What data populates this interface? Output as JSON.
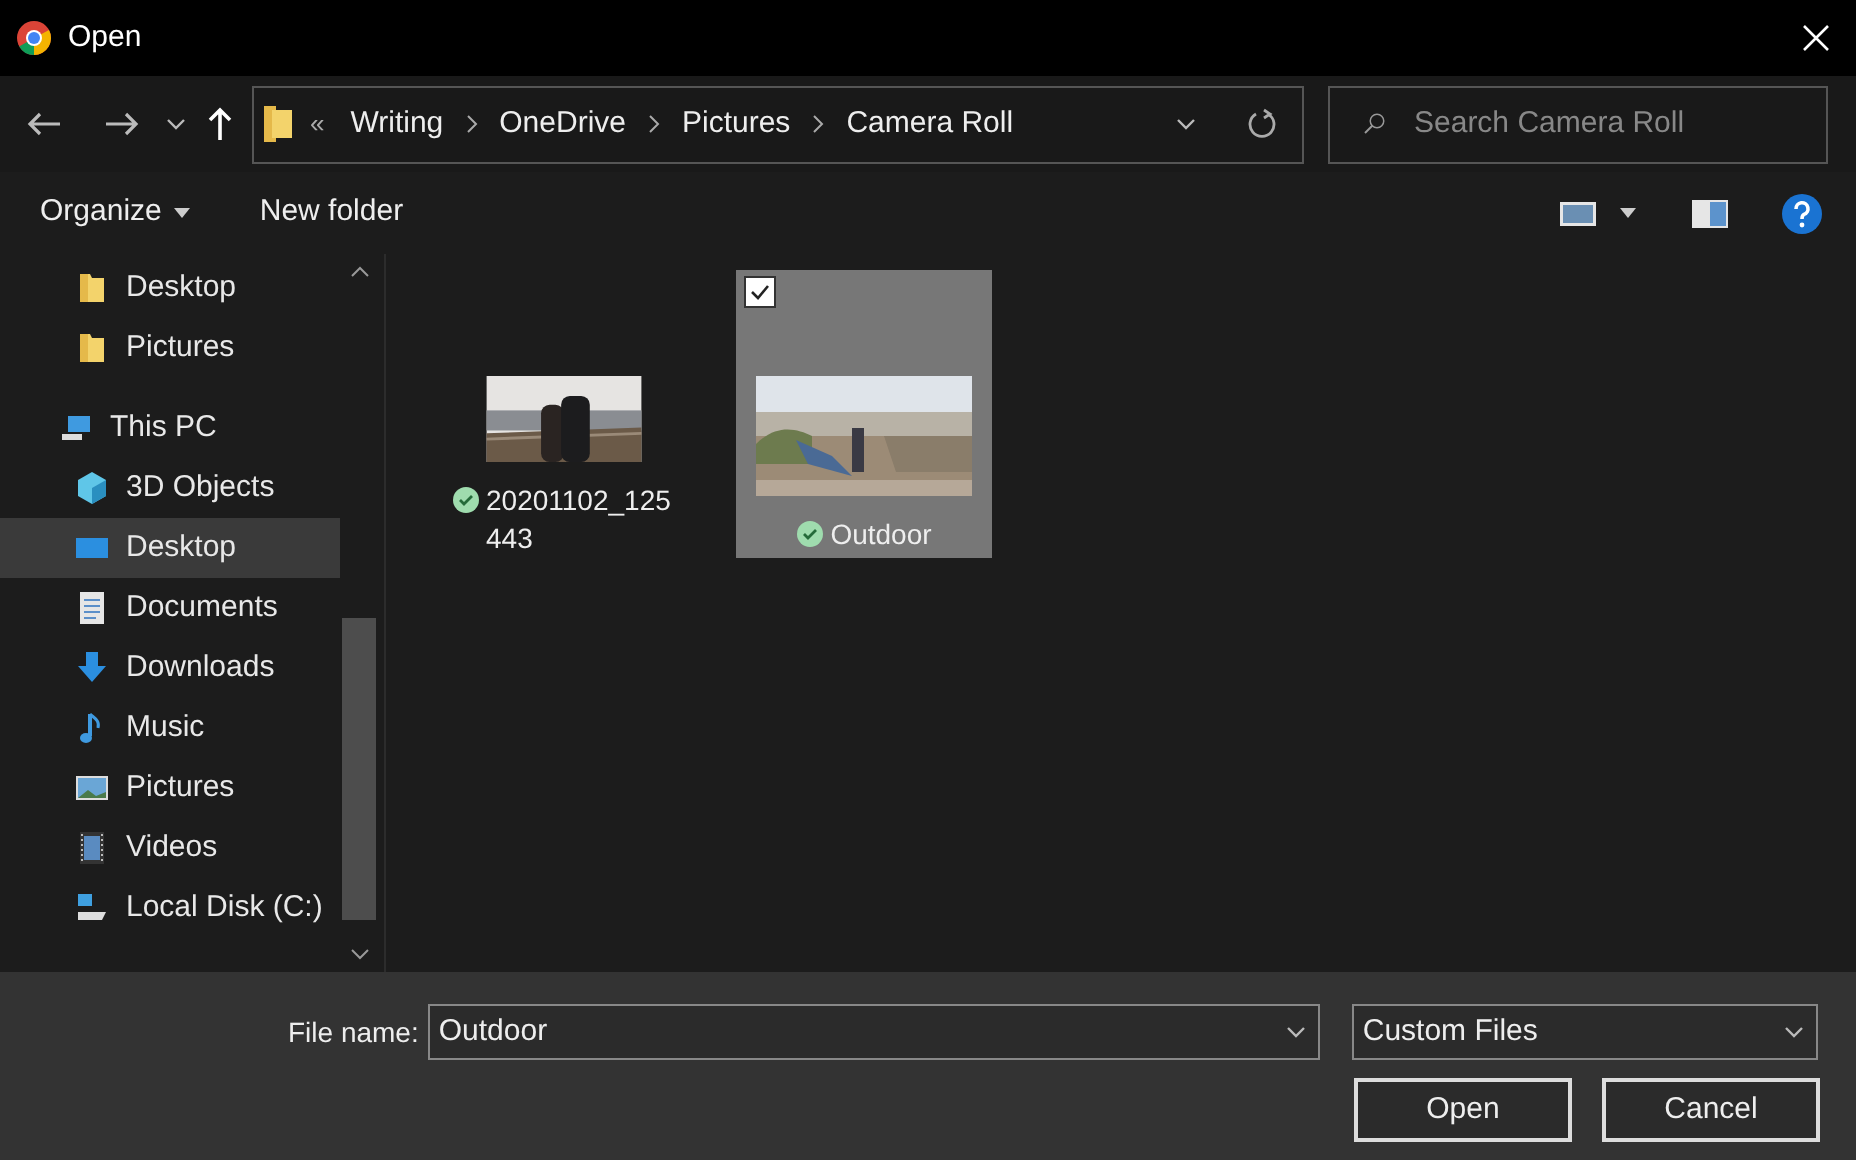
{
  "window": {
    "title": "Open"
  },
  "address_bar": {
    "overflow": "«",
    "crumbs": [
      "Writing",
      "OneDrive",
      "Pictures",
      "Camera Roll"
    ]
  },
  "search": {
    "placeholder": "Search Camera Roll"
  },
  "toolbar": {
    "organize": "Organize",
    "new_folder": "New folder"
  },
  "sidebar": {
    "pinned": [
      {
        "label": "Desktop",
        "kind": "folder",
        "selected": false
      },
      {
        "label": "Pictures",
        "kind": "folder",
        "selected": false
      }
    ],
    "tree": [
      {
        "label": "This PC",
        "kind": "pc",
        "selected": false,
        "children": [
          {
            "label": "3D Objects",
            "kind": "cube",
            "selected": false
          },
          {
            "label": "Desktop",
            "kind": "desktop",
            "selected": true
          },
          {
            "label": "Documents",
            "kind": "document",
            "selected": false
          },
          {
            "label": "Downloads",
            "kind": "download",
            "selected": false
          },
          {
            "label": "Music",
            "kind": "music",
            "selected": false
          },
          {
            "label": "Pictures",
            "kind": "pictures",
            "selected": false
          },
          {
            "label": "Videos",
            "kind": "videos",
            "selected": false
          },
          {
            "label": "Local Disk (C:)",
            "kind": "disk",
            "selected": false
          }
        ]
      }
    ]
  },
  "files": [
    {
      "name": "20201102_125443",
      "selected": false,
      "checked": false,
      "kind": "picture"
    },
    {
      "name": "Outdoor",
      "selected": true,
      "checked": true,
      "kind": "picture"
    }
  ],
  "file_name": {
    "label": "File name:",
    "value": "Outdoor"
  },
  "file_type": {
    "value": "Custom Files"
  },
  "buttons": [
    "Open",
    "Cancel"
  ]
}
